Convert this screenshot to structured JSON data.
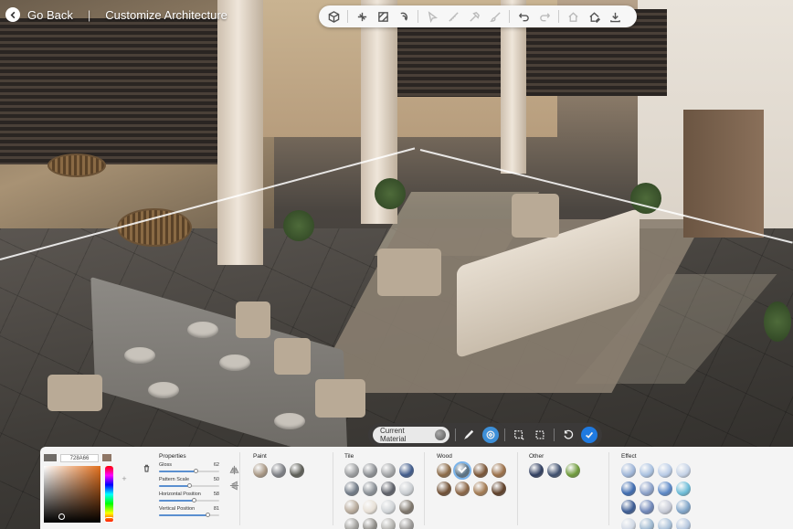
{
  "header": {
    "back_label": "Go Back",
    "title": "Customize Architecture"
  },
  "toolbar": {
    "icons": [
      "cube-icon",
      "rotate-axis-icon",
      "texture-icon",
      "paint-roller-icon",
      "cursor-icon",
      "measure-icon",
      "hammer-icon",
      "brush-icon",
      "undo-icon",
      "redo-icon",
      "house-outline-icon",
      "house-edit-icon",
      "download-icon"
    ]
  },
  "material_bar": {
    "current_material_label": "Current Material"
  },
  "color_picker": {
    "hex": "728A66",
    "old_color": "#6e6a66",
    "new_color": "#8f7665"
  },
  "properties": {
    "title": "Properties",
    "items": [
      {
        "label": "Gloss",
        "value": "62",
        "level": 0.62
      },
      {
        "label": "Pattern Scale",
        "value": "50",
        "level": 0.5
      },
      {
        "label": "Horizontal Position",
        "value": "58",
        "level": 0.58
      },
      {
        "label": "Vertical Position",
        "value": "81",
        "level": 0.81
      }
    ]
  },
  "groups": {
    "paint": {
      "title": "Paint",
      "swatches": [
        "#a89784",
        "#7d7f84",
        "#5c5d56"
      ]
    },
    "tile": {
      "title": "Tile",
      "swatches": [
        "#9b9d9f",
        "#8c8f93",
        "#a2a4a6",
        "#3f5a8a",
        "#707a86",
        "#8a9096",
        "#5d6068",
        "#c9cdd1",
        "#b7aa9b",
        "#e6dfd5",
        "#cfd3d6",
        "#7d756a",
        "#a09f9b",
        "#8f8d88",
        "#b3b2ae",
        "#9a9896"
      ]
    },
    "wood": {
      "title": "Wood",
      "swatches": [
        "#8b6a47",
        "#5a7386",
        "#7a5536",
        "#9a6f48",
        "#6e4e33",
        "#8a6545",
        "#a27a52",
        "#5e3f28"
      ],
      "selected": 1
    },
    "other": {
      "title": "Other",
      "swatches": [
        "#2f3d5f",
        "#3e4f6e",
        "#6e9a3a"
      ]
    },
    "effect": {
      "title": "Effect",
      "swatches": [
        "#9fb6d8",
        "#a9c1e0",
        "#b8cbe6",
        "#c4d2e6",
        "#3f6cb0",
        "#8aa0c8",
        "#5a87c6",
        "#6cbcd8",
        "#3b5b93",
        "#6e86b8",
        "#c6cad6",
        "#7fa4c8",
        "#d0d8e4",
        "#9db8d0",
        "#a8c0d8",
        "#b4c6de"
      ]
    }
  }
}
